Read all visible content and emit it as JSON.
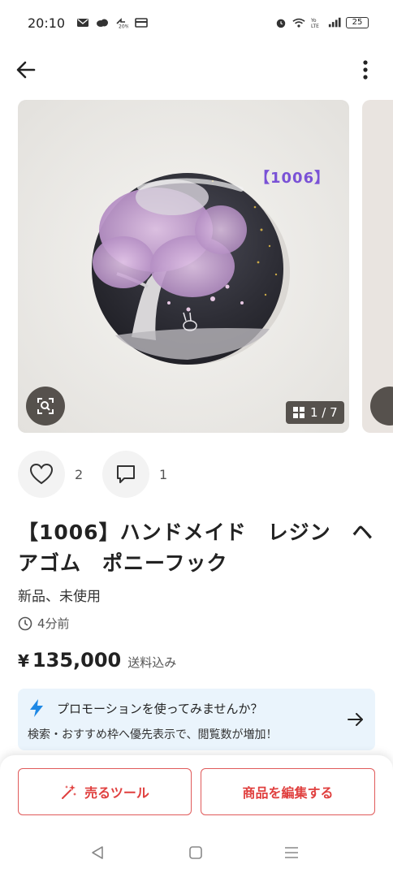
{
  "status_bar": {
    "time": "20:10",
    "battery": "25",
    "icons": [
      "mail-icon",
      "cloud-icon",
      "data-saver-icon",
      "wallet-icon",
      "alarm-icon",
      "wifi-icon",
      "volte-icon",
      "signal-icon",
      "battery-icon"
    ]
  },
  "nav": {
    "back_icon": "arrow-left-icon",
    "more_icon": "more-vertical-icon"
  },
  "gallery": {
    "photo_tag": "【1006】",
    "current": "1",
    "total": "7",
    "counter": "1 / 7",
    "zoom_icon": "image-search-icon"
  },
  "reactions": {
    "likes": "2",
    "comments": "1"
  },
  "item": {
    "title": "【1006】ハンドメイド　レジン　ヘアゴム　ポニーフック",
    "condition": "新品、未使用",
    "posted": "4分前",
    "price_symbol": "¥",
    "price": "135,000",
    "shipping": "送料込み"
  },
  "promotion": {
    "title": "プロモーションを使ってみませんか？",
    "body": "検索・おすすめ枠へ優先表示で、閲覧数が増加！"
  },
  "actions": {
    "sell_tool": "売るツール",
    "edit_item": "商品を編集する"
  },
  "colors": {
    "accent": "#e0403f",
    "promo_bg": "#eaf4fc",
    "promo_icon": "#1e88e5"
  }
}
